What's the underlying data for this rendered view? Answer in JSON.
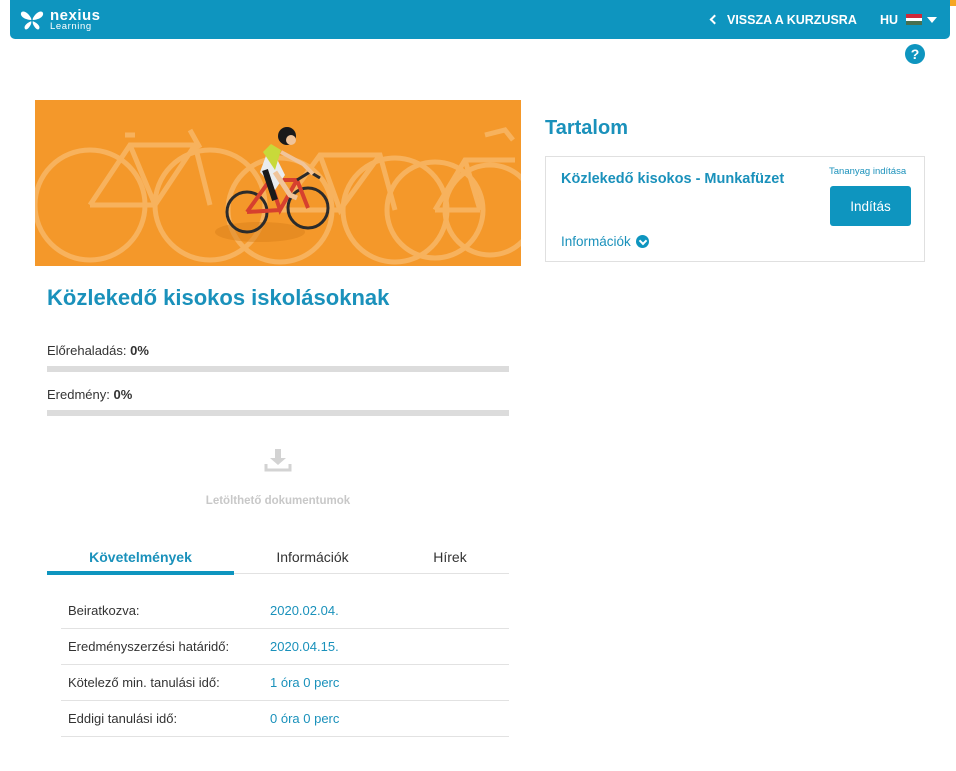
{
  "header": {
    "logo_line1": "nexius",
    "logo_line2": "Learning",
    "back_label": "VISSZA A KURZUSRA",
    "language": "HU",
    "flag_colors": [
      "#ce2939",
      "#ffffff",
      "#477050"
    ],
    "help_label": "?"
  },
  "course": {
    "title": "Közlekedő kisokos iskolásoknak",
    "progress_label": "Előrehaladás:",
    "progress_value": "0%",
    "progress_fraction": 0,
    "result_label": "Eredmény:",
    "result_value": "0%",
    "result_fraction": 0,
    "downloads_label": "Letölthető dokumentumok"
  },
  "tabs": [
    {
      "label": "Követelmények",
      "active": true
    },
    {
      "label": "Információk",
      "active": false
    },
    {
      "label": "Hírek",
      "active": false
    }
  ],
  "requirements": [
    {
      "key": "Beiratkozva:",
      "value": "2020.02.04."
    },
    {
      "key": "Eredményszerzési határidő:",
      "value": "2020.04.15."
    },
    {
      "key": "Kötelező min. tanulási idő:",
      "value": "1 óra 0 perc"
    },
    {
      "key": "Eddigi tanulási idő:",
      "value": "0 óra 0 perc"
    }
  ],
  "toc": {
    "title": "Tartalom",
    "item_name": "Közlekedő kisokos - Munkafüzet",
    "launch_label": "Tananyag indítása",
    "start_button": "Indítás",
    "info_label": "Információk"
  },
  "colors": {
    "brand": "#0e95bf",
    "banner": "#f4982a",
    "link": "#1a91bb"
  }
}
